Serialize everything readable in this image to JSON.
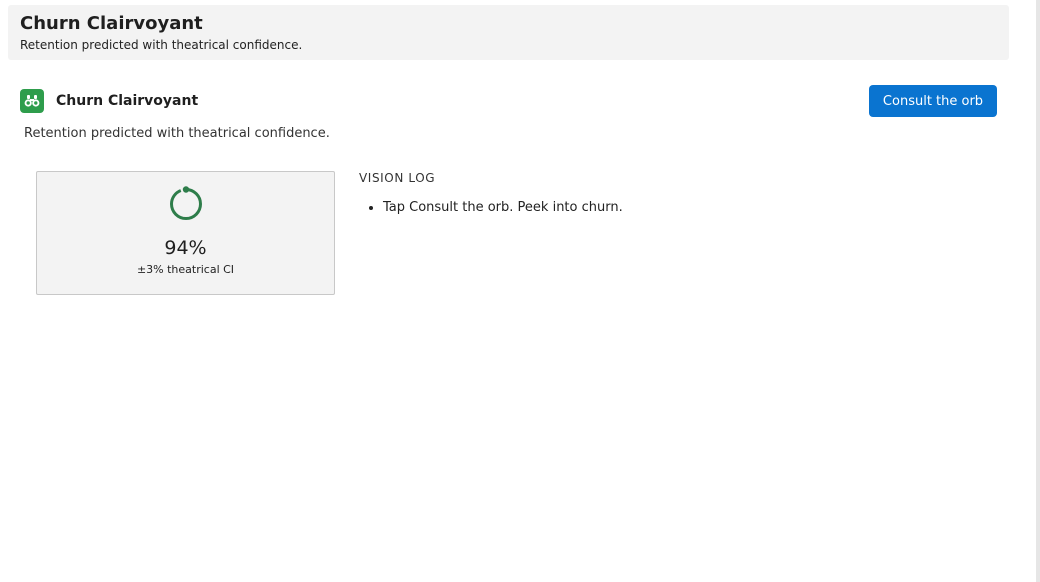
{
  "app": {
    "title": "Churn Clairvoyant",
    "subtitle": "Retention predicted with theatrical confidence."
  },
  "card": {
    "icon": "binoculars-icon",
    "title": "Churn Clairvoyant",
    "description": "Retention predicted with theatrical confidence.",
    "action_label": "Consult the orb"
  },
  "metric": {
    "value": "94%",
    "confidence_interval": "±3% theatrical CI",
    "progress_fraction": 0.94
  },
  "log": {
    "heading": "VISION LOG",
    "items": [
      "Tap Consult the orb. Peek into churn."
    ]
  },
  "colors": {
    "accent": "#0a74d0",
    "brand": "#2e9d4c",
    "orb": "#2e7d4a"
  }
}
